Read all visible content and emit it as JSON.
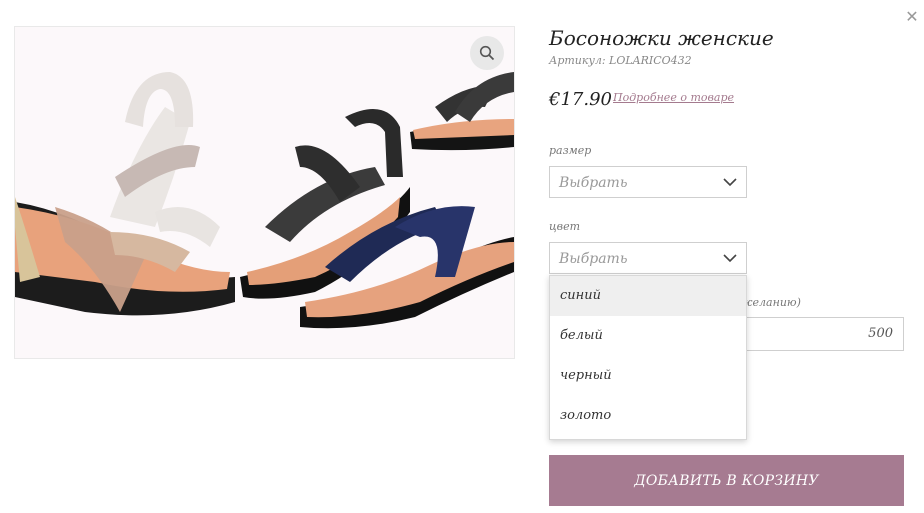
{
  "product": {
    "title": "Босоножки женские",
    "sku": "Артикул: LOLARICO432",
    "price": "€17.90",
    "more_link": "Подробнее о товаре"
  },
  "size": {
    "label": "размер",
    "value": "Выбрать"
  },
  "color": {
    "label": "цвет",
    "value": "Выбрать",
    "options": [
      "синий",
      "белый",
      "черный",
      "золото"
    ]
  },
  "quantity": {
    "label_tail": "желанию)",
    "value": "500"
  },
  "add_to_cart": "ДОБАВИТЬ В КОРЗИНУ",
  "icons": {
    "close": "close-icon",
    "zoom": "zoom-icon",
    "chevron": "chevron-down-icon"
  },
  "colors": {
    "accent": "#a67b91",
    "link": "#a47a8e"
  }
}
